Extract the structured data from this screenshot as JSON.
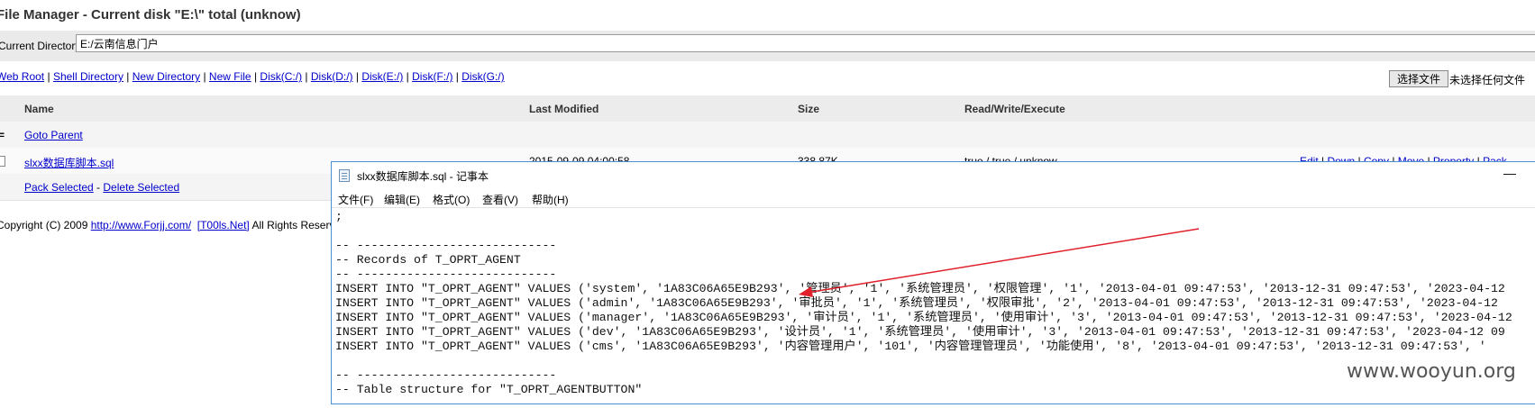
{
  "header": {
    "title": "File Manager - Current disk \"E:\\\" total (unknow)"
  },
  "current_directory": {
    "label": "Current Directory",
    "value": "E:/云南信息门户"
  },
  "toolbar": {
    "links": [
      "Web Root",
      "Shell Directory",
      "New Directory",
      "New File",
      "Disk(C:/)",
      "Disk(D:/)",
      "Disk(E:/)",
      "Disk(F:/)",
      "Disk(G:/)"
    ],
    "separator": " | ",
    "file_button": "选择文件",
    "file_status": "未选择任何文件"
  },
  "table": {
    "columns": [
      "Name",
      "Last Modified",
      "Size",
      "Read/Write/Execute"
    ],
    "goto_parent": "Goto Parent",
    "file": {
      "name": "slxx数据库脚本.sql",
      "modified": "2015-09-09 04:00:58",
      "size": "338.87K",
      "rwx": "true / true / unknow",
      "actions": [
        "Edit",
        "Down",
        "Copy",
        "Move",
        "Property",
        "Pack"
      ]
    },
    "pack_selected": "Pack Selected",
    "delete_selected": "Delete Selected",
    "dash": " - "
  },
  "footer": {
    "text_before": "Copyright (C) 2009 ",
    "link1": "http://www.Forjj.com/",
    "link2": "[T00ls.Net]",
    "text_after": " All Rights Reserved"
  },
  "notepad": {
    "title": "slxx数据库脚本.sql - 记事本",
    "minimize": "—",
    "menu": [
      "文件(F)",
      "编辑(E)",
      "格式(O)",
      "查看(V)",
      "帮助(H)"
    ],
    "lines": [
      ";",
      "",
      "-- ----------------------------",
      "-- Records of T_OPRT_AGENT",
      "-- ----------------------------",
      "INSERT INTO \"T_OPRT_AGENT\" VALUES ('system', '1A83C06A65E9B293', '管理员', '1', '系统管理员', '权限管理', '1', '2013-04-01 09:47:53', '2013-12-31 09:47:53', '2023-04-12",
      "INSERT INTO \"T_OPRT_AGENT\" VALUES ('admin', '1A83C06A65E9B293', '审批员', '1', '系统管理员', '权限审批', '2', '2013-04-01 09:47:53', '2013-12-31 09:47:53', '2023-04-12",
      "INSERT INTO \"T_OPRT_AGENT\" VALUES ('manager', '1A83C06A65E9B293', '审计员', '1', '系统管理员', '使用审计', '3', '2013-04-01 09:47:53', '2013-12-31 09:47:53', '2023-04-12",
      "INSERT INTO \"T_OPRT_AGENT\" VALUES ('dev', '1A83C06A65E9B293', '设计员', '1', '系统管理员', '使用审计', '3', '2013-04-01 09:47:53', '2013-12-31 09:47:53', '2023-04-12 09",
      "INSERT INTO \"T_OPRT_AGENT\" VALUES ('cms', '1A83C06A65E9B293', '内容管理用户', '101', '内容管理管理员', '功能使用', '8', '2013-04-01 09:47:53', '2013-12-31 09:47:53', '",
      "",
      "-- ----------------------------",
      "-- Table structure for \"T_OPRT_AGENTBUTTON\""
    ]
  },
  "watermark": "www.wooyun.org",
  "colors": {
    "link": "#0000cc",
    "annotation_arrow": "#e0202a",
    "window_border": "#4a8fd4"
  }
}
